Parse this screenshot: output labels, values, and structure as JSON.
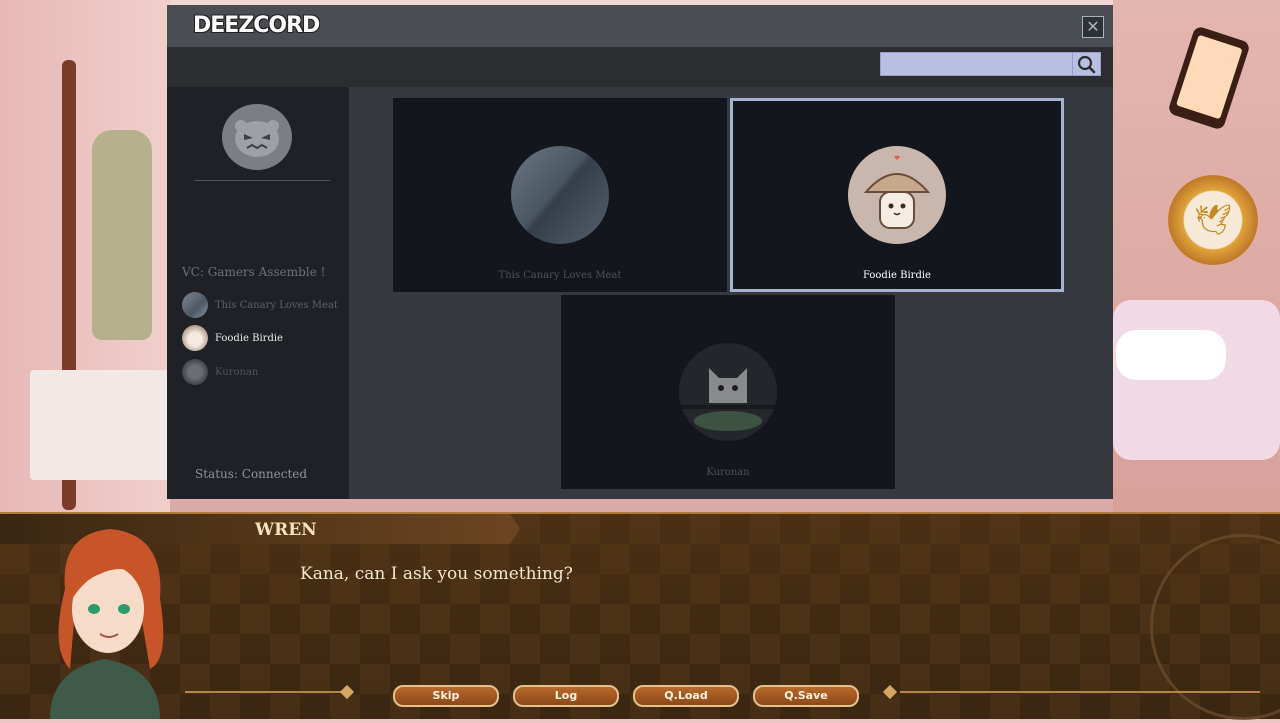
{
  "app": {
    "logo": "DEEZCORD",
    "search": {
      "placeholder": "",
      "value": ""
    },
    "voice_channel": "VC: Gamers Assemble !",
    "status": "Status: Connected",
    "members": [
      {
        "name": "This Canary Loves Meat",
        "active": false,
        "color": "#6c747f"
      },
      {
        "name": "Foodie Birdie",
        "active": true,
        "color": "#e5d2c8"
      },
      {
        "name": "Kuronan",
        "active": false,
        "color": "#4a4d54"
      }
    ],
    "tiles": [
      {
        "name": "This Canary Loves Meat",
        "active": false
      },
      {
        "name": "Foodie Birdie",
        "active": true
      },
      {
        "name": "Kuronan",
        "active": false
      }
    ]
  },
  "dialogue": {
    "speaker": "WREN",
    "text": "Kana, can I ask you something?"
  },
  "controls": {
    "skip": "Skip",
    "log": "Log",
    "qload": "Q.Load",
    "qsave": "Q.Save"
  },
  "colors": {
    "accent": "#a6b2cf",
    "dialog_bg": "#3a2611",
    "button": "#a45a24"
  }
}
